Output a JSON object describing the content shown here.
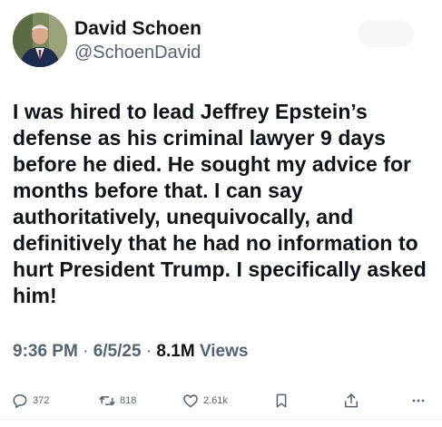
{
  "author": {
    "display_name": "David Schoen",
    "handle": "@SchoenDavid"
  },
  "tweet": {
    "text": "I was hired to lead Jeffrey Epstein’s\ndefense as his criminal lawyer 9 days\nbefore he died.  He sought my advice for\nmonths before that.  I can say\nauthoritatively, unequivocally, and\ndefinitively that he had no information to\nhurt President Trump.  I specifically asked\nhim!",
    "time": "9:36 PM",
    "separator": "·",
    "date": "6/5/25",
    "views_count": "8.1M",
    "views_label": "Views"
  },
  "actions": {
    "replies": "372",
    "retweets": "818",
    "likes": "2.61k"
  },
  "icons": {
    "reply": "reply-icon",
    "retweet": "retweet-icon",
    "like": "heart-icon",
    "bookmark": "bookmark-icon",
    "share": "share-icon",
    "more": "more-icon"
  },
  "colors": {
    "text": "#0f1419",
    "secondary": "#536471"
  }
}
